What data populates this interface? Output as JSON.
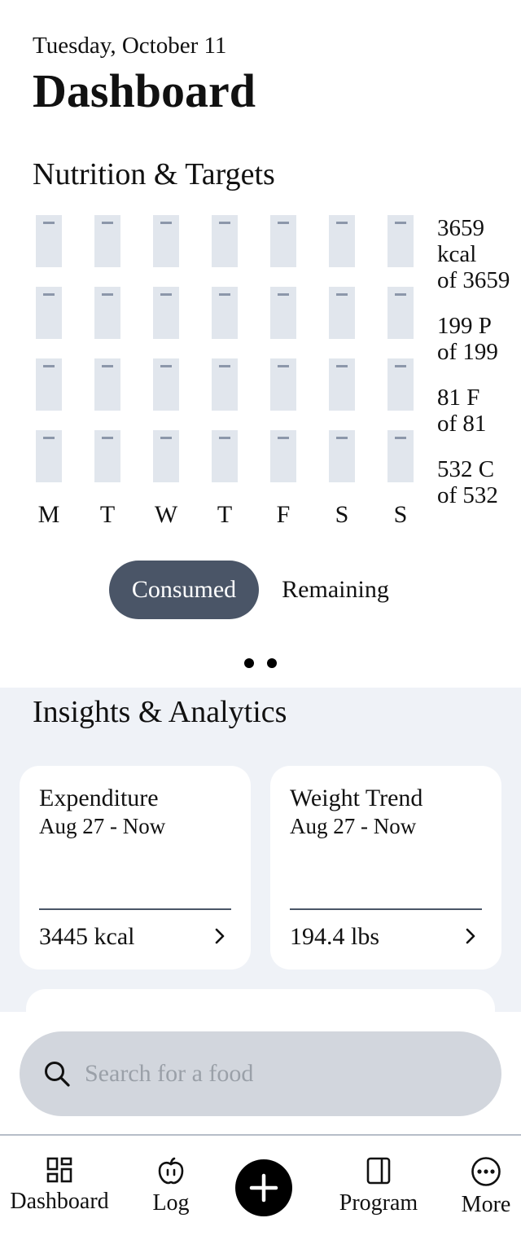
{
  "header": {
    "date": "Tuesday, October 11",
    "title": "Dashboard"
  },
  "nutrition": {
    "title": "Nutrition & Targets",
    "days": [
      "M",
      "T",
      "W",
      "T",
      "F",
      "S",
      "S"
    ],
    "rows": [
      "calories",
      "protein",
      "fat",
      "carbs"
    ],
    "macros": [
      {
        "value": "3659",
        "unit": "kcal",
        "target": "of 3659"
      },
      {
        "value": "199 P",
        "target": "of 199"
      },
      {
        "value": "81 F",
        "target": "of 81"
      },
      {
        "value": "532 C",
        "target": "of 532"
      }
    ],
    "toggle": {
      "active": "Consumed",
      "inactive": "Remaining"
    },
    "pager": {
      "pages": 2
    }
  },
  "insights": {
    "title": "Insights & Analytics",
    "cards": [
      {
        "title": "Expenditure",
        "range": "Aug 27 - Now",
        "value": "3445 kcal"
      },
      {
        "title": "Weight Trend",
        "range": "Aug 27 - Now",
        "value": "194.4 lbs"
      }
    ]
  },
  "search": {
    "placeholder": "Search for a food"
  },
  "tabs": {
    "dashboard": "Dashboard",
    "log": "Log",
    "program": "Program",
    "more": "More"
  },
  "colors": {
    "accent": "#4a5567",
    "cell": "#e1e6ed",
    "insights_bg": "#eff2f7",
    "search_bg": "#d2d6dd"
  }
}
